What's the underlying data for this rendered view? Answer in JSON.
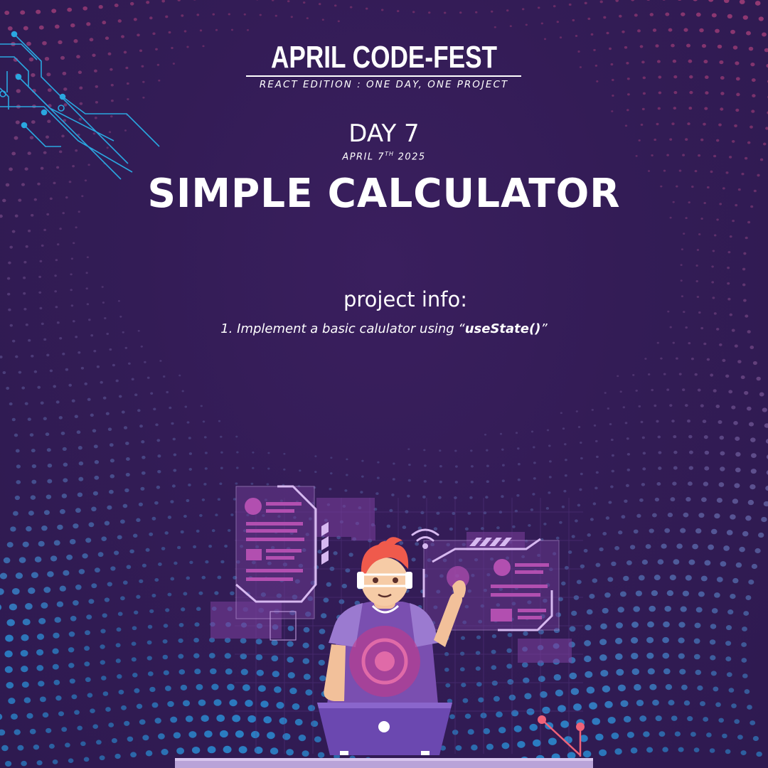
{
  "header": {
    "title": "APRIL CODE-FEST",
    "subtitle": "REACT EDITION : ONE DAY, ONE PROJECT"
  },
  "day": {
    "label": "DAY 7",
    "date_prefix": "APRIL 7",
    "date_suffix": "TH",
    "date_year": " 2025"
  },
  "project": {
    "title": "SIMPLE CALCULATOR",
    "info_heading": "project info:",
    "items": [
      {
        "prefix": "1. Implement a basic calulator using “",
        "code": "useState()",
        "suffix": "”"
      }
    ]
  },
  "colors": {
    "background": "#331c56",
    "text": "#ffffff",
    "circuit": "#2aa7e0",
    "dots_warm": "#d94f8a",
    "dots_cool": "#2a8fd6"
  },
  "icons": [
    "circuit-lines-decoration",
    "developer-illustration",
    "wifi-icon",
    "laptop-icon"
  ]
}
